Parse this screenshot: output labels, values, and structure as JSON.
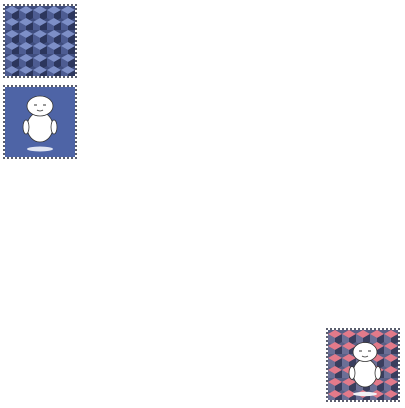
{
  "tiles": [
    {
      "name": "cube-pattern-tile",
      "pattern": "isometric-cubes",
      "colors": {
        "top": "#7d8fc7",
        "left": "#3f4d7f",
        "right": "#2c365d"
      }
    },
    {
      "name": "robot-tile-blue",
      "pattern": "robot-on-solid",
      "colors": {
        "background": "#4e64a6",
        "robot": "#ffffff",
        "shadow": "#dfe4f2"
      }
    },
    {
      "name": "robot-tile-pink",
      "pattern": "robot-on-cubes",
      "colors": {
        "top": "#e37a8a",
        "left": "#5a5f86",
        "right": "#3a3e5e",
        "robot": "#ffffff"
      }
    }
  ]
}
